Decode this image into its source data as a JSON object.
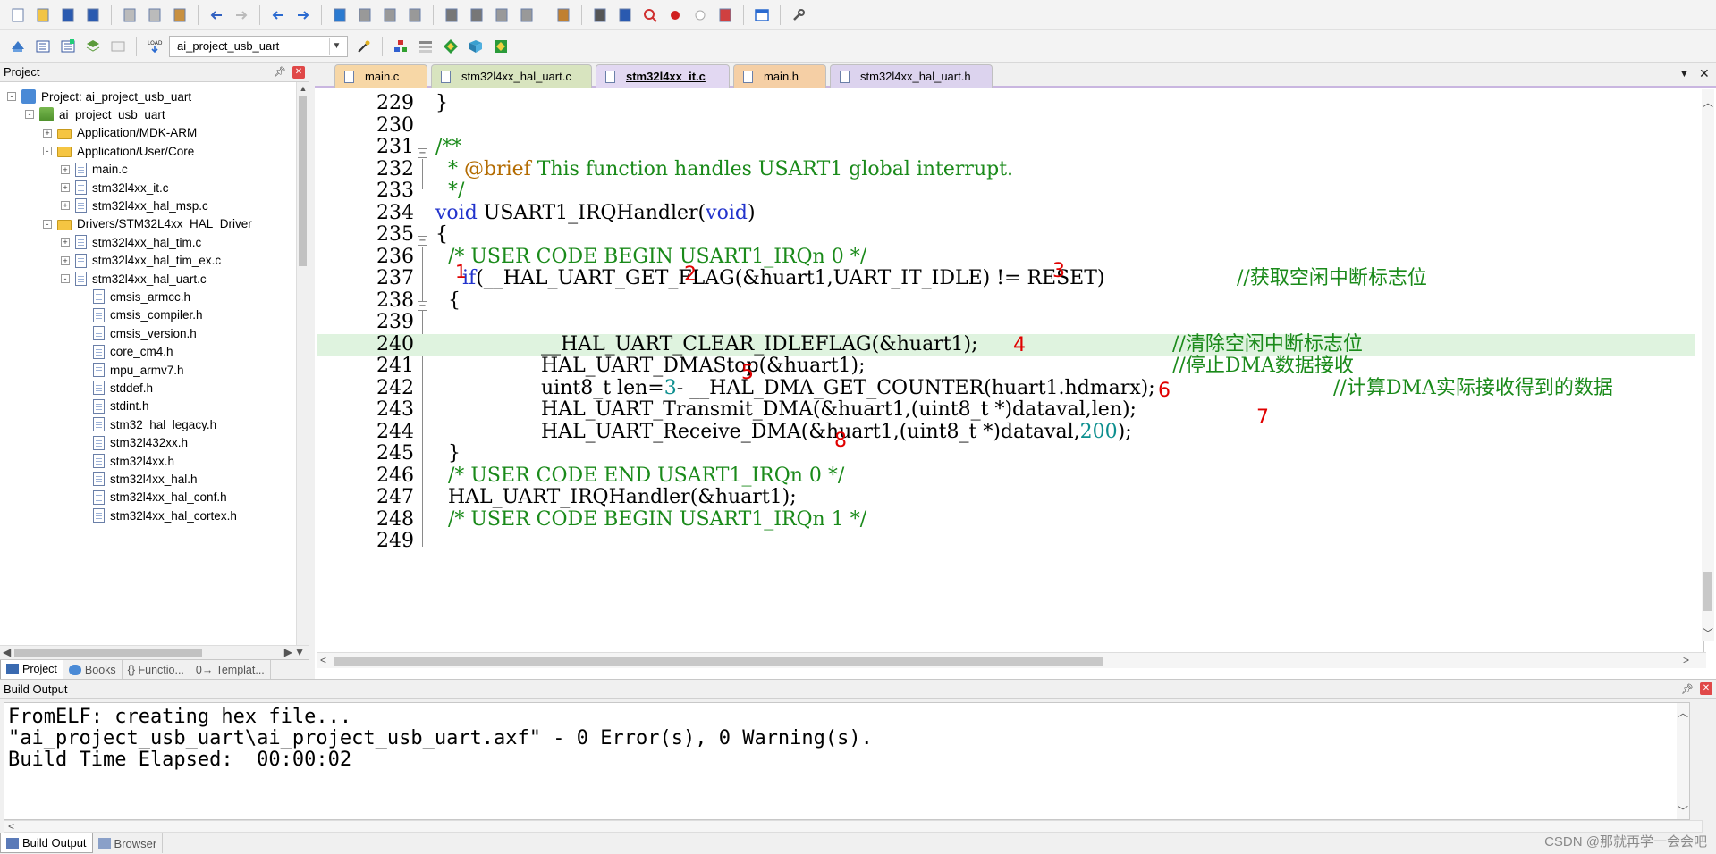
{
  "toolbar_row1": {
    "buttons": [
      "new-file-icon",
      "open-file-icon",
      "save-icon",
      "save-all-icon",
      "cut-icon",
      "copy-icon",
      "paste-icon",
      "undo-icon",
      "redo-icon",
      "navigate-back-icon",
      "navigate-forward-icon",
      "bookmark-icon",
      "prev-bookmark-icon",
      "next-bookmark-icon",
      "clear-bookmarks-icon",
      "indent-icon",
      "unindent-icon",
      "comment-icon",
      "uncomment-icon",
      "find-in-files-icon",
      "find-icon",
      "incremental-find-icon",
      "debug-session-icon",
      "breakpoint-icon",
      "disable-breakpoint-icon",
      "kill-breakpoints-icon",
      "window-layout-icon",
      "configure-icon"
    ]
  },
  "toolbar_row2": {
    "target_select": "ai_project_usb_uart",
    "load_label": "LOAD"
  },
  "project_panel": {
    "title": "Project",
    "tree": [
      {
        "label": "Project: ai_project_usb_uart",
        "depth": 0,
        "exp": "-",
        "icon": "project"
      },
      {
        "label": "ai_project_usb_uart",
        "depth": 1,
        "exp": "-",
        "icon": "target"
      },
      {
        "label": "Application/MDK-ARM",
        "depth": 2,
        "exp": "+",
        "icon": "folder"
      },
      {
        "label": "Application/User/Core",
        "depth": 2,
        "exp": "-",
        "icon": "folder"
      },
      {
        "label": "main.c",
        "depth": 3,
        "exp": "+",
        "icon": "file"
      },
      {
        "label": "stm32l4xx_it.c",
        "depth": 3,
        "exp": "+",
        "icon": "file"
      },
      {
        "label": "stm32l4xx_hal_msp.c",
        "depth": 3,
        "exp": "+",
        "icon": "file"
      },
      {
        "label": "Drivers/STM32L4xx_HAL_Driver",
        "depth": 2,
        "exp": "-",
        "icon": "folder"
      },
      {
        "label": "stm32l4xx_hal_tim.c",
        "depth": 3,
        "exp": "+",
        "icon": "file"
      },
      {
        "label": "stm32l4xx_hal_tim_ex.c",
        "depth": 3,
        "exp": "+",
        "icon": "file"
      },
      {
        "label": "stm32l4xx_hal_uart.c",
        "depth": 3,
        "exp": "-",
        "icon": "file"
      },
      {
        "label": "cmsis_armcc.h",
        "depth": 4,
        "exp": "",
        "icon": "file"
      },
      {
        "label": "cmsis_compiler.h",
        "depth": 4,
        "exp": "",
        "icon": "file"
      },
      {
        "label": "cmsis_version.h",
        "depth": 4,
        "exp": "",
        "icon": "file"
      },
      {
        "label": "core_cm4.h",
        "depth": 4,
        "exp": "",
        "icon": "file"
      },
      {
        "label": "mpu_armv7.h",
        "depth": 4,
        "exp": "",
        "icon": "file"
      },
      {
        "label": "stddef.h",
        "depth": 4,
        "exp": "",
        "icon": "file"
      },
      {
        "label": "stdint.h",
        "depth": 4,
        "exp": "",
        "icon": "file"
      },
      {
        "label": "stm32_hal_legacy.h",
        "depth": 4,
        "exp": "",
        "icon": "file"
      },
      {
        "label": "stm32l432xx.h",
        "depth": 4,
        "exp": "",
        "icon": "file"
      },
      {
        "label": "stm32l4xx.h",
        "depth": 4,
        "exp": "",
        "icon": "file"
      },
      {
        "label": "stm32l4xx_hal.h",
        "depth": 4,
        "exp": "",
        "icon": "file"
      },
      {
        "label": "stm32l4xx_hal_conf.h",
        "depth": 4,
        "exp": "",
        "icon": "file"
      },
      {
        "label": "stm32l4xx_hal_cortex.h",
        "depth": 4,
        "exp": "",
        "icon": "file"
      }
    ],
    "tabs": [
      "Project",
      "Books",
      "{} Functio...",
      "0→ Templat..."
    ]
  },
  "editor": {
    "tabs": [
      {
        "label": "main.c",
        "style": "c-file"
      },
      {
        "label": "stm32l4xx_hal_uart.c",
        "style": "hal-file"
      },
      {
        "label": "stm32l4xx_it.c",
        "style": "active"
      },
      {
        "label": "main.h",
        "style": "h-file"
      },
      {
        "label": "stm32l4xx_hal_uart.h",
        "style": "h2-file"
      }
    ],
    "line_numbers": [
      "229",
      "230",
      "231",
      "232",
      "233",
      "234",
      "235",
      "236",
      "237",
      "238",
      "239",
      "240",
      "241",
      "242",
      "243",
      "244",
      "245",
      "246",
      "247",
      "248",
      "249"
    ],
    "lines": {
      "l229": "}",
      "l231": "/**",
      "l232_a": "  * ",
      "l232_brief": "@brief",
      "l232_b": " This function handles USART1 global interrupt.",
      "l233": "  */",
      "l234_kw1": "void",
      "l234_mid": " USART1_IRQHandler(",
      "l234_kw2": "void",
      "l234_end": ")",
      "l235": "{",
      "l236": "  /* USER CODE BEGIN USART1_IRQn 0 */",
      "l237_kw": "if",
      "l237_code": "(__HAL_UART_GET_FLAG(&huart1,UART_IT_IDLE) != RESET)",
      "l237_cmt": "//获取空闲中断标志位",
      "l238": "  {",
      "l240_code": "__HAL_UART_CLEAR_IDLEFLAG(&huart1);",
      "l240_cmt": "//清除空闲中断标志位",
      "l241_code": "HAL_UART_DMAStop(&huart1);",
      "l241_cmt": "//停止DMA数据接收",
      "l242_a": "uint8_t len=",
      "l242_num": "3",
      "l242_b": "- __HAL_DMA_GET_COUNTER(huart1.hdmarx);",
      "l242_cmt": "//计算DMA实际接收得到的数据",
      "l243_code": "HAL_UART_Transmit_DMA(&huart1,(uint8_t *)dataval,len);",
      "l244_a": "HAL_UART_Receive_DMA(&huart1,(uint8_t *)dataval,",
      "l244_num": "200",
      "l244_b": ");",
      "l245": "  }",
      "l246": "  /* USER CODE END USART1_IRQn 0 */",
      "l247": "  HAL_UART_IRQHandler(&huart1);",
      "l248": "  /* USER CODE BEGIN USART1_IRQn 1 */"
    },
    "annotations": [
      "1",
      "2",
      "3",
      "4",
      "5",
      "6",
      "7",
      "8"
    ]
  },
  "build_output": {
    "title": "Build Output",
    "lines": [
      "FromELF: creating hex file...",
      "\"ai_project_usb_uart\\ai_project_usb_uart.axf\" - 0 Error(s), 0 Warning(s).",
      "Build Time Elapsed:  00:00:02"
    ],
    "tabs": [
      "Build Output",
      "Browser"
    ],
    "watermark": "CSDN @那就再学一会会吧"
  }
}
